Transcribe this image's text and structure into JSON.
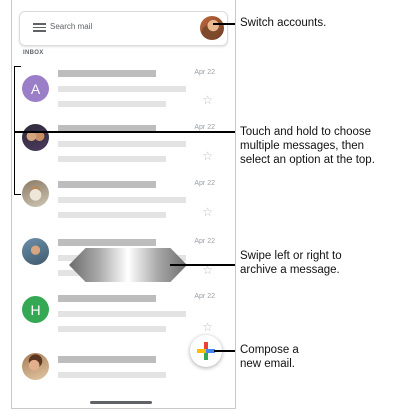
{
  "search": {
    "placeholder_text": "Search mail"
  },
  "inbox_label": "INBOX",
  "emails": [
    {
      "avatar_type": "letter",
      "avatar_letter": "A",
      "avatar_color": "#9b7ec8",
      "date": "Apr 22"
    },
    {
      "avatar_type": "photo",
      "date": "Apr 22"
    },
    {
      "avatar_type": "photo",
      "date": "Apr 22"
    },
    {
      "avatar_type": "photo",
      "date": "Apr 22"
    },
    {
      "avatar_type": "letter",
      "avatar_letter": "H",
      "avatar_color": "#34a853",
      "date": "Apr 22"
    },
    {
      "avatar_type": "photo",
      "date": ""
    }
  ],
  "callouts": {
    "switch_accounts": [
      "Switch accounts."
    ],
    "touch_hold": [
      "Touch and hold to choose",
      "multiple messages, then",
      "select an option at the top."
    ],
    "swipe": [
      "Swipe left or right to",
      "archive a message."
    ],
    "compose": [
      "Compose a",
      "new email."
    ]
  },
  "icons": {
    "menu": "menu-icon",
    "star": "star-icon",
    "compose": "compose-plus-icon"
  },
  "colors": {
    "compose_red": "#ea4335",
    "compose_yellow": "#fbbc05",
    "compose_green": "#34a853",
    "compose_blue": "#4285f4"
  }
}
